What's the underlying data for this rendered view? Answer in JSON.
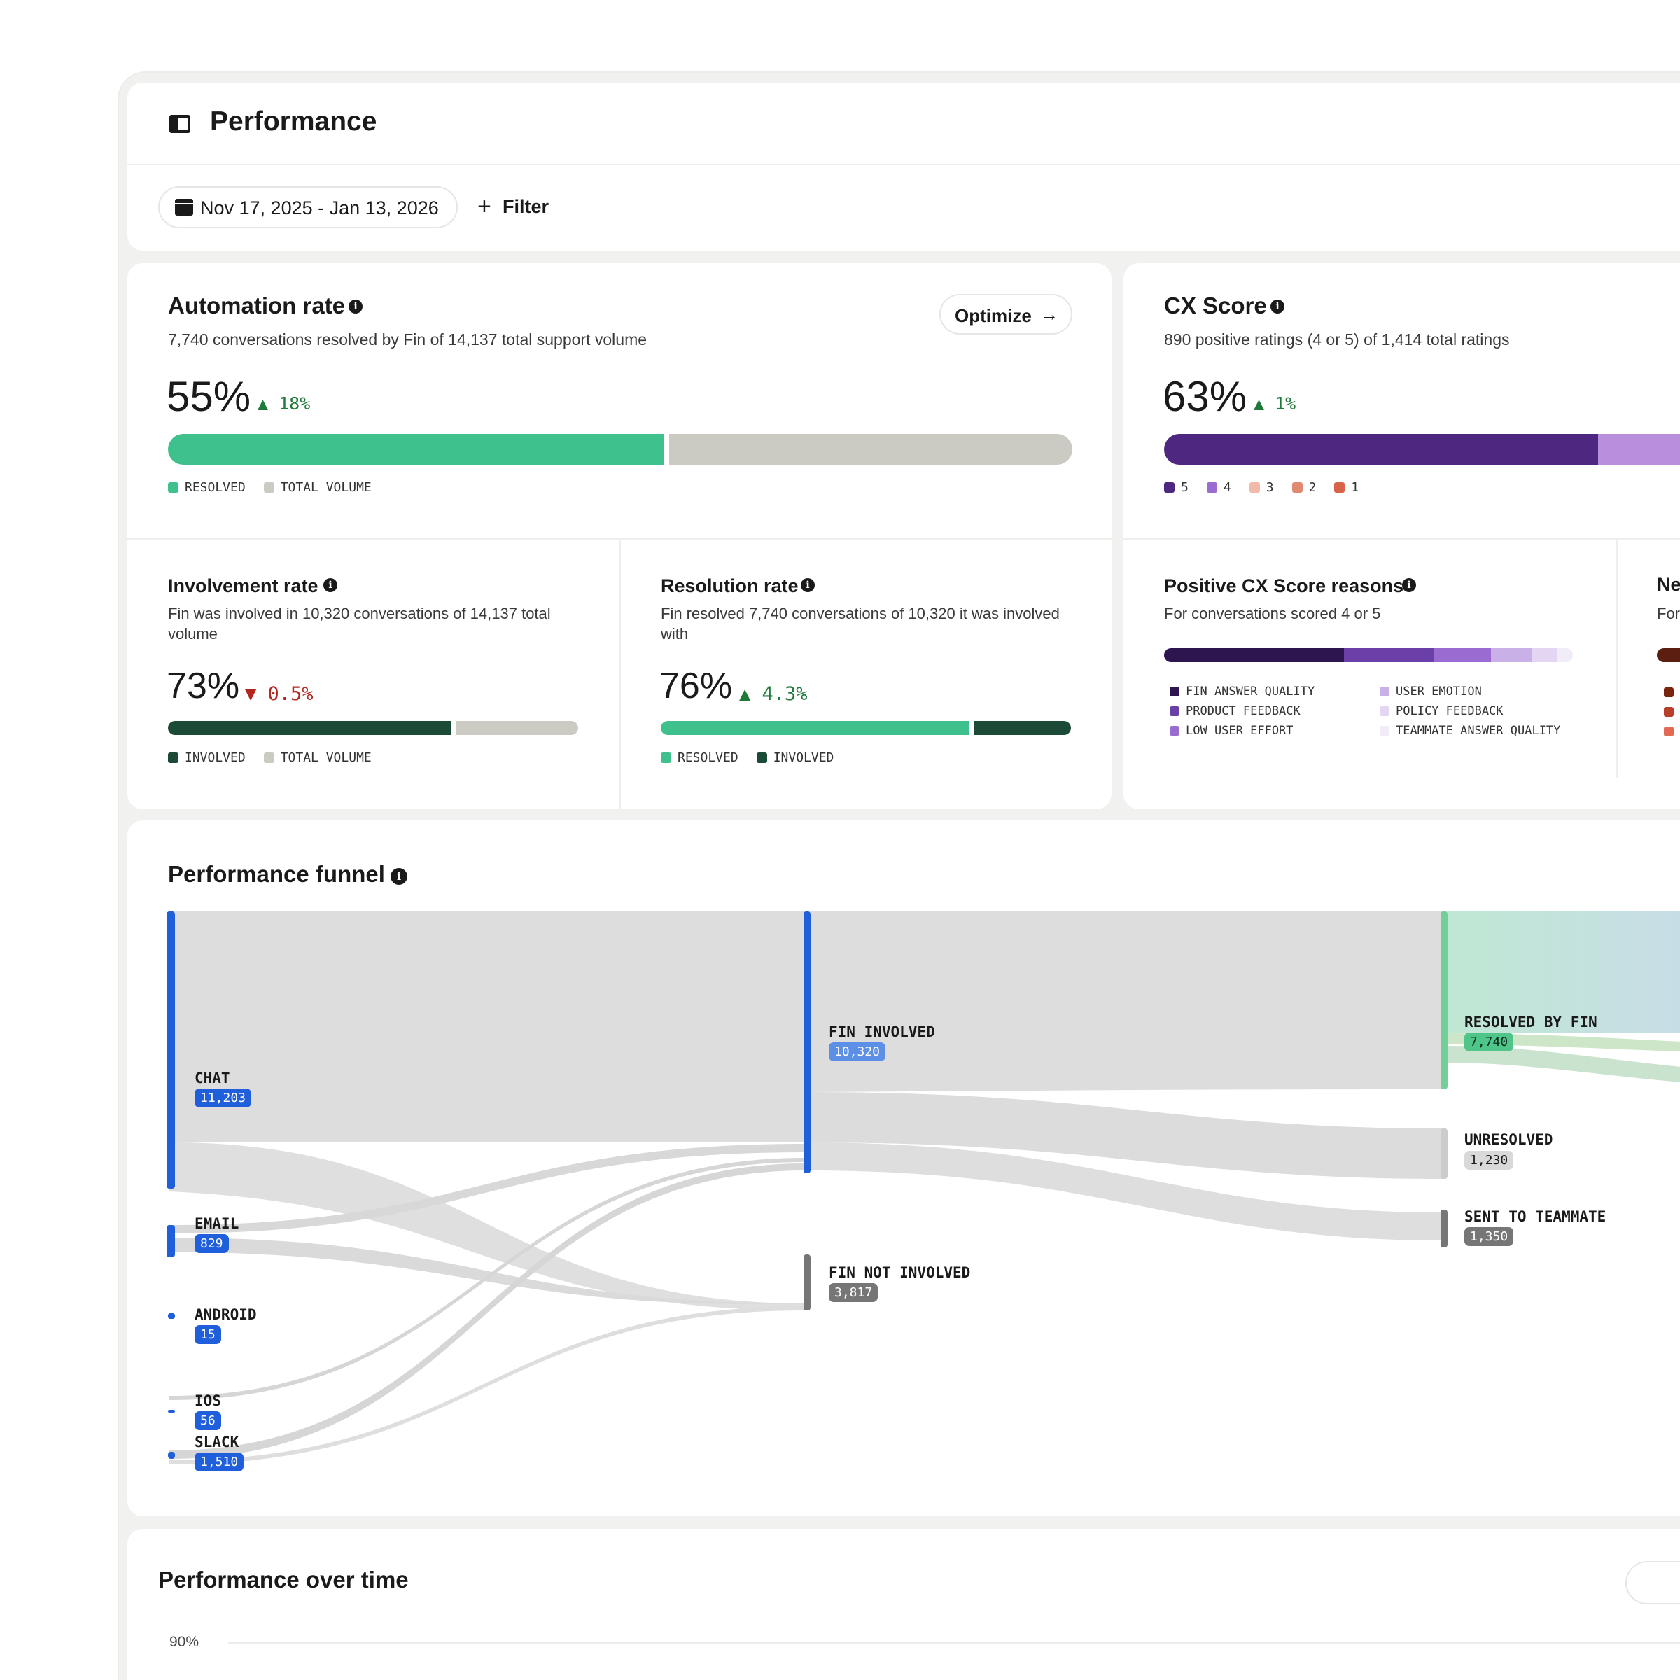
{
  "header": {
    "title": "Performance",
    "date_range": "Nov 17, 2025 - Jan 13, 2026",
    "filter_label": "Filter"
  },
  "automation": {
    "title": "Automation rate",
    "subtitle": "7,740 conversations resolved by Fin of 14,137 total support volume",
    "value": "55%",
    "delta": "18%",
    "optimize_label": "Optimize",
    "bar_fraction": 0.548,
    "legend": [
      "RESOLVED",
      "TOTAL VOLUME"
    ]
  },
  "involvement": {
    "title": "Involvement rate",
    "subtitle": "Fin was involved in 10,320 conversations of 14,137 total volume",
    "value": "73%",
    "delta": "0.5%",
    "bar_fraction": 0.73,
    "legend": [
      "INVOLVED",
      "TOTAL VOLUME"
    ]
  },
  "resolution": {
    "title": "Resolution rate",
    "subtitle": "Fin resolved 7,740 conversations of 10,320 it was involved with",
    "value": "76%",
    "delta": "4.3%",
    "bar_fraction": 0.75,
    "legend": [
      "RESOLVED",
      "INVOLVED"
    ]
  },
  "cx": {
    "title": "CX Score",
    "subtitle": "890 positive ratings (4 or 5) of 1,414 total ratings",
    "value": "63%",
    "delta": "1%",
    "legend": [
      "5",
      "4",
      "3",
      "2",
      "1"
    ]
  },
  "reasons": {
    "title": "Positive CX Score reasons",
    "subtitle": "For conversations scored 4 or 5",
    "legend_left": [
      "FIN ANSWER QUALITY",
      "PRODUCT FEEDBACK",
      "LOW USER EFFORT"
    ],
    "legend_right": [
      "USER EMOTION",
      "POLICY FEEDBACK",
      "TEAMMATE ANSWER QUALITY"
    ],
    "segments": [
      0.44,
      0.22,
      0.14,
      0.1,
      0.06,
      0.04
    ]
  },
  "reasons_neg": {
    "title_partial": "Ne",
    "subtitle_partial": "For"
  },
  "funnel": {
    "title": "Performance funnel",
    "sources": [
      {
        "label": "CHAT",
        "count": "11,203"
      },
      {
        "label": "EMAIL",
        "count": "829"
      },
      {
        "label": "ANDROID",
        "count": "15"
      },
      {
        "label": "IOS",
        "count": "56"
      },
      {
        "label": "SLACK",
        "count": "1,510"
      }
    ],
    "mid": [
      {
        "label": "FIN INVOLVED",
        "count": "10,320"
      },
      {
        "label": "FIN NOT INVOLVED",
        "count": "3,817"
      }
    ],
    "outcomes": [
      {
        "label": "RESOLVED BY FIN",
        "count": "7,740"
      },
      {
        "label": "UNRESOLVED",
        "count": "1,230"
      },
      {
        "label": "SENT TO TEAMMATE",
        "count": "1,350"
      }
    ]
  },
  "over_time": {
    "title": "Performance over time",
    "y_tick": "90%"
  },
  "colors": {
    "green": "#3fc18d",
    "gray": "#cbcbc4",
    "dark_green": "#1b4a36",
    "blue": "#1f5fdc",
    "purple_dark": "#4d2780",
    "purple_light": "#b98fdc"
  }
}
